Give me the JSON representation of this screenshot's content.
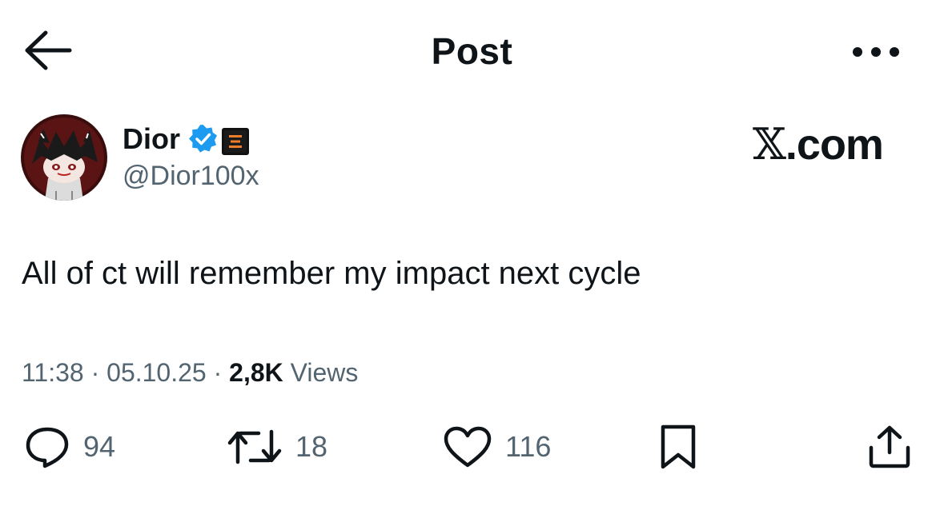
{
  "header": {
    "title": "Post",
    "back_icon": "arrow-left-icon",
    "more_icon": "more-horizontal-icon"
  },
  "author": {
    "display_name": "Dior",
    "handle": "@Dior100x",
    "verified_icon": "verified-badge-icon",
    "affiliation_icon": "affiliation-badge-icon"
  },
  "watermark": {
    "x_glyph": "𝕏",
    "text": ".com"
  },
  "post": {
    "text": "All of ct will remember my impact next cycle"
  },
  "meta": {
    "time": "11:38",
    "date": "05.10.25",
    "views_count": "2,8K",
    "views_label": "Views",
    "separator": "·"
  },
  "actions": {
    "replies": "94",
    "reposts": "18",
    "likes": "116"
  },
  "colors": {
    "text": "#0f1419",
    "secondary": "#536471",
    "verified": "#1d9bf0"
  }
}
